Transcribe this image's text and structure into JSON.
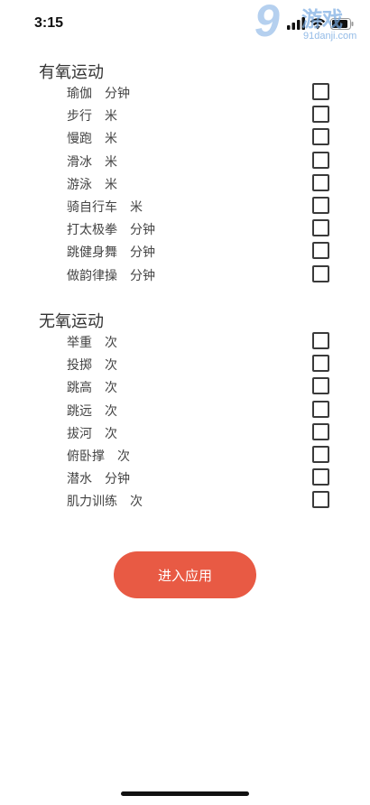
{
  "status_bar": {
    "time": "3:15"
  },
  "watermark": {
    "logo_text": "9",
    "title": "游戏",
    "url": "91danji.com"
  },
  "sections": [
    {
      "title": "有氧运动",
      "items": [
        {
          "name": "瑜伽",
          "unit": "分钟",
          "checked": false
        },
        {
          "name": "步行",
          "unit": "米",
          "checked": false
        },
        {
          "name": "慢跑",
          "unit": "米",
          "checked": false
        },
        {
          "name": "滑冰",
          "unit": "米",
          "checked": false
        },
        {
          "name": "游泳",
          "unit": "米",
          "checked": false
        },
        {
          "name": "骑自行车",
          "unit": "米",
          "checked": false
        },
        {
          "name": "打太极拳",
          "unit": "分钟",
          "checked": false
        },
        {
          "name": "跳健身舞",
          "unit": "分钟",
          "checked": false
        },
        {
          "name": "做韵律操",
          "unit": "分钟",
          "checked": false
        }
      ]
    },
    {
      "title": "无氧运动",
      "items": [
        {
          "name": "举重",
          "unit": "次",
          "checked": false
        },
        {
          "name": "投掷",
          "unit": "次",
          "checked": false
        },
        {
          "name": "跳高",
          "unit": "次",
          "checked": false
        },
        {
          "name": "跳远",
          "unit": "次",
          "checked": false
        },
        {
          "name": "拔河",
          "unit": "次",
          "checked": false
        },
        {
          "name": "俯卧撑",
          "unit": "次",
          "checked": false
        },
        {
          "name": "潜水",
          "unit": "分钟",
          "checked": false
        },
        {
          "name": "肌力训练",
          "unit": "次",
          "checked": false
        }
      ]
    }
  ],
  "enter_button": {
    "label": "进入应用"
  },
  "colors": {
    "accent": "#e85a44",
    "text": "#333333",
    "checkbox_border": "#3a3a3a"
  }
}
